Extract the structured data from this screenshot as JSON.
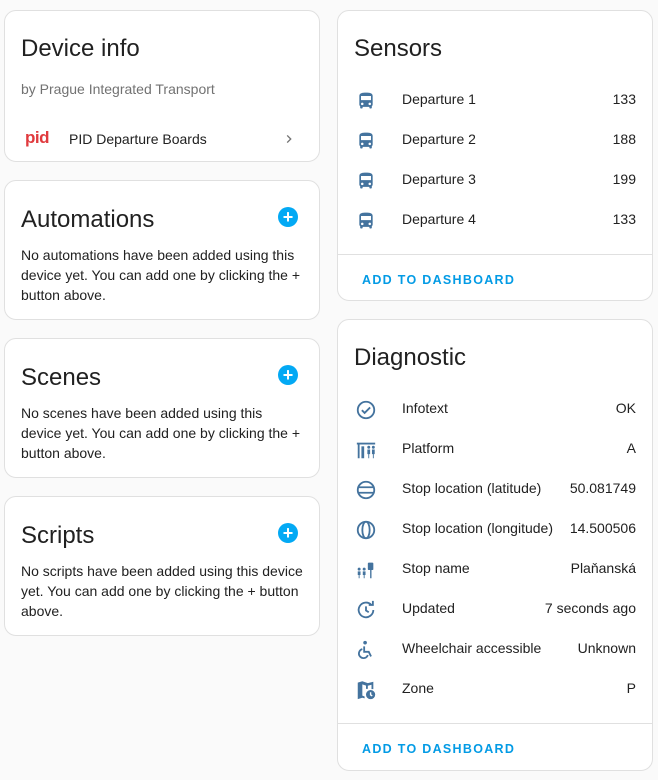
{
  "colors": {
    "accent": "#03a9f4",
    "icon": "#44739e",
    "pid_red": "#e03a3e"
  },
  "device_info": {
    "title": "Device info",
    "manufacturer": "by Prague Integrated Transport",
    "logo_text": "pid",
    "link_label": "PID Departure Boards"
  },
  "automations": {
    "title": "Automations",
    "add_symbol": "+",
    "empty_text": "No automations have been added using this device yet. You can add one by clicking the + button above."
  },
  "scenes": {
    "title": "Scenes",
    "add_symbol": "+",
    "empty_text": "No scenes have been added using this device yet. You can add one by clicking the + button above."
  },
  "scripts": {
    "title": "Scripts",
    "add_symbol": "+",
    "empty_text": "No scripts have been added using this device yet. You can add one by clicking the + button above."
  },
  "sensors": {
    "title": "Sensors",
    "items": [
      {
        "label": "Departure 1",
        "value": "133",
        "icon": "bus-icon"
      },
      {
        "label": "Departure 2",
        "value": "188",
        "icon": "bus-icon"
      },
      {
        "label": "Departure 3",
        "value": "199",
        "icon": "bus-icon"
      },
      {
        "label": "Departure 4",
        "value": "133",
        "icon": "bus-icon"
      }
    ],
    "action_label": "ADD TO DASHBOARD"
  },
  "diagnostic": {
    "title": "Diagnostic",
    "items": [
      {
        "label": "Infotext",
        "value": "OK",
        "icon": "check-circle-icon"
      },
      {
        "label": "Platform",
        "value": "A",
        "icon": "platform-icon"
      },
      {
        "label": "Stop location (latitude)",
        "value": "50.081749",
        "icon": "latitude-icon"
      },
      {
        "label": "Stop location (longitude)",
        "value": "14.500506",
        "icon": "longitude-icon"
      },
      {
        "label": "Stop name",
        "value": "Plaňanská",
        "icon": "bus-stop-icon"
      },
      {
        "label": "Updated",
        "value": "7 seconds ago",
        "icon": "update-icon"
      },
      {
        "label": "Wheelchair accessible",
        "value": "Unknown",
        "icon": "wheelchair-icon"
      },
      {
        "label": "Zone",
        "value": "P",
        "icon": "map-clock-icon"
      }
    ],
    "action_label": "ADD TO DASHBOARD"
  }
}
